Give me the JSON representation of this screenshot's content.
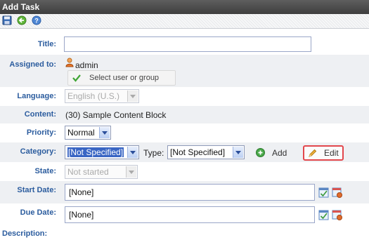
{
  "window": {
    "title": "Add Task"
  },
  "toolbar": {
    "icons": [
      "save-icon",
      "back-icon",
      "help-icon"
    ]
  },
  "form": {
    "title": {
      "label": "Title:",
      "value": ""
    },
    "assigned_to": {
      "label": "Assigned to:",
      "user": "admin",
      "select_label": "Select user or group"
    },
    "language": {
      "label": "Language:",
      "value": "English (U.S.)"
    },
    "content": {
      "label": "Content:",
      "value": "(30) Sample Content Block"
    },
    "priority": {
      "label": "Priority:",
      "value": "Normal"
    },
    "category": {
      "label": "Category:",
      "value": "[Not Specified]",
      "type_label": "Type:",
      "type_value": "[Not Specified]",
      "add_label": "Add",
      "edit_label": "Edit"
    },
    "state": {
      "label": "State:",
      "value": "Not started"
    },
    "start_date": {
      "label": "Start Date:",
      "value": "[None]"
    },
    "due_date": {
      "label": "Due Date:",
      "value": "[None]"
    },
    "description": {
      "label": "Description:"
    }
  },
  "colors": {
    "label_blue": "#2b5c9e",
    "titlebar": "#4a4a4a",
    "edit_highlight": "#e2474c",
    "selection_blue": "#3a66c4"
  }
}
